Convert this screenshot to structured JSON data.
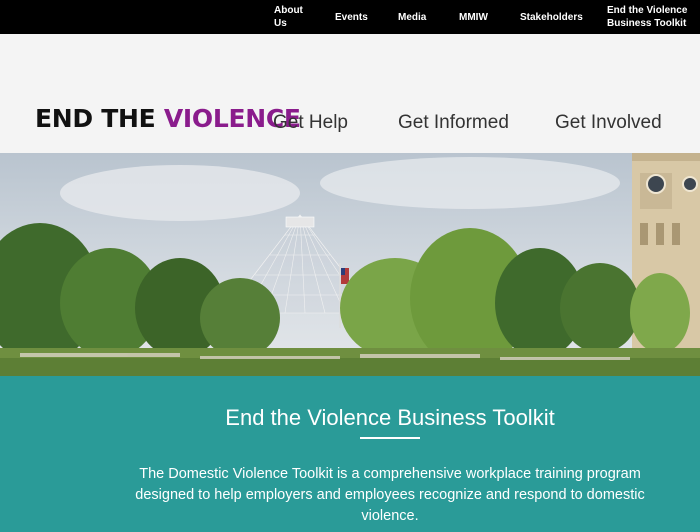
{
  "top_nav": {
    "items": [
      {
        "label": "About Us"
      },
      {
        "label": "Events"
      },
      {
        "label": "Media"
      },
      {
        "label": "MMIW"
      },
      {
        "label": "Stakeholders"
      },
      {
        "label": "End the Violence Business Toolkit"
      }
    ]
  },
  "logo": {
    "part1": "END THE ",
    "part2": "VIOLENCE"
  },
  "main_nav": {
    "items": [
      {
        "label": "Get Help"
      },
      {
        "label": "Get Informed"
      },
      {
        "label": "Get Involved"
      }
    ]
  },
  "hero": {
    "image_description": "Park scene with trees, pavilion, flag and clock tower"
  },
  "section": {
    "title": "End the Violence Business Toolkit",
    "body": "The Domestic Violence Toolkit is a comprehensive workplace training program designed to help employers and employees recognize and respond to domestic violence."
  },
  "colors": {
    "top_nav_bg": "#000000",
    "header_bg": "#f4f4f4",
    "logo_accent": "#8a1c8c",
    "teal_bg": "#2a9b98"
  }
}
